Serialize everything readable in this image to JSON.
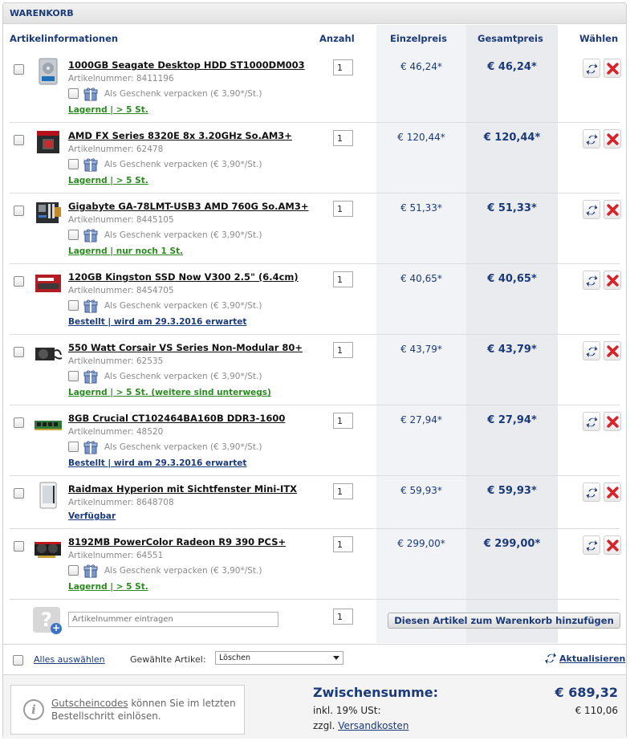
{
  "cart": {
    "title": "WARENKORB"
  },
  "columns": {
    "info": "Artikelinformationen",
    "qty": "Anzahl",
    "unit": "Einzelpreis",
    "total": "Gesamtpreis",
    "select": "Wählen"
  },
  "gift_label": "Als Geschenk verpacken (€ 3,90*/St.)",
  "artnr_prefix": "Artikelnummer:",
  "items": [
    {
      "name": "1000GB Seagate Desktop HDD ST1000DM003",
      "artnr": "8411196",
      "gift": true,
      "stock": "Lagernd | > 5 St.",
      "stock_color": "#2a8a1f",
      "qty": "1",
      "unit": "€ 46,24*",
      "total": "€ 46,24*",
      "icon": "hdd-icon"
    },
    {
      "name": "AMD FX Series 8320E 8x 3.20GHz So.AM3+",
      "artnr": "62478",
      "gift": true,
      "stock": "Lagernd | > 5 St.",
      "stock_color": "#2a8a1f",
      "qty": "1",
      "unit": "€ 120,44*",
      "total": "€ 120,44*",
      "icon": "cpu-box-icon"
    },
    {
      "name": "Gigabyte GA-78LMT-USB3 AMD 760G So.AM3+",
      "artnr": "8445105",
      "gift": true,
      "stock": "Lagernd | nur noch 1 St.",
      "stock_color": "#2a8a1f",
      "qty": "1",
      "unit": "€ 51,33*",
      "total": "€ 51,33*",
      "icon": "mainboard-icon"
    },
    {
      "name": "120GB Kingston SSD Now V300 2.5\" (6.4cm)",
      "artnr": "8454705",
      "gift": true,
      "stock": "Bestellt | wird am 29.3.2016 erwartet",
      "stock_color": "#1b3a7a",
      "qty": "1",
      "unit": "€ 40,65*",
      "total": "€ 40,65*",
      "icon": "ssd-icon"
    },
    {
      "name": "550 Watt Corsair VS Series Non-Modular 80+",
      "artnr": "62535",
      "gift": true,
      "stock": "Lagernd | > 5 St. (weitere sind unterwegs)",
      "stock_color": "#2a8a1f",
      "qty": "1",
      "unit": "€ 43,79*",
      "total": "€ 43,79*",
      "icon": "psu-icon"
    },
    {
      "name": "8GB Crucial CT102464BA160B DDR3-1600",
      "artnr": "48520",
      "gift": true,
      "stock": "Bestellt | wird am 29.3.2016 erwartet",
      "stock_color": "#1b3a7a",
      "qty": "1",
      "unit": "€ 27,94*",
      "total": "€ 27,94*",
      "icon": "ram-icon"
    },
    {
      "name": "Raidmax Hyperion mit Sichtfenster Mini-ITX",
      "artnr": "8648708",
      "gift": false,
      "stock": "Verfügbar",
      "stock_color": "#1b3a7a",
      "qty": "1",
      "unit": "€ 59,93*",
      "total": "€ 59,93*",
      "icon": "pc-case-icon"
    },
    {
      "name": "8192MB PowerColor Radeon R9 390 PCS+",
      "artnr": "64551",
      "gift": true,
      "stock": "Lagernd | > 5 St.",
      "stock_color": "#2a8a1f",
      "qty": "1",
      "unit": "€ 299,00*",
      "total": "€ 299,00*",
      "icon": "gpu-icon"
    }
  ],
  "add_row": {
    "placeholder": "Artikelnummer eintragen",
    "qty": "1",
    "button": "Diesen Artikel zum Warenkorb hinzufügen"
  },
  "actions": {
    "select_all": "Alles auswählen",
    "selected_label": "Gewählte Artikel:",
    "selected_option": "Löschen",
    "refresh": "Aktualisieren"
  },
  "footer": {
    "voucher_link": "Gutscheincodes",
    "voucher_text": " können Sie im letzten Bestellschritt einlösen.",
    "subtotal_label": "Zwischensumme:",
    "subtotal_value": "€ 689,32",
    "tax_label": "inkl. 19% USt:",
    "tax_value": "€ 110,06",
    "shipping_prefix": "zzgl. ",
    "shipping_link": "Versandkosten"
  },
  "colors": {
    "accent": "#1b3a7a",
    "in_stock": "#2a8a1f",
    "delete": "#d8232a"
  }
}
